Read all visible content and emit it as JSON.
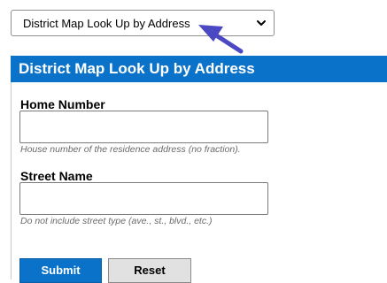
{
  "selector": {
    "value": "District Map Look Up by Address"
  },
  "panel": {
    "title": "District Map Look Up by Address"
  },
  "form": {
    "home_number": {
      "label": "Home Number",
      "value": "",
      "hint": "House number of the residence address (no fraction)."
    },
    "street_name": {
      "label": "Street Name",
      "value": "",
      "hint": "Do not include street type (ave., st., blvd., etc.)"
    },
    "submit_label": "Submit",
    "reset_label": "Reset"
  },
  "colors": {
    "header_bg": "#0a73c9",
    "submit_bg": "#0a73c9",
    "reset_bg": "#e1e1e1",
    "annotation_arrow": "#4a48c2"
  },
  "icons": {
    "select_chevron": "chevron-down-icon",
    "annotation": "arrow-annotation-icon"
  }
}
